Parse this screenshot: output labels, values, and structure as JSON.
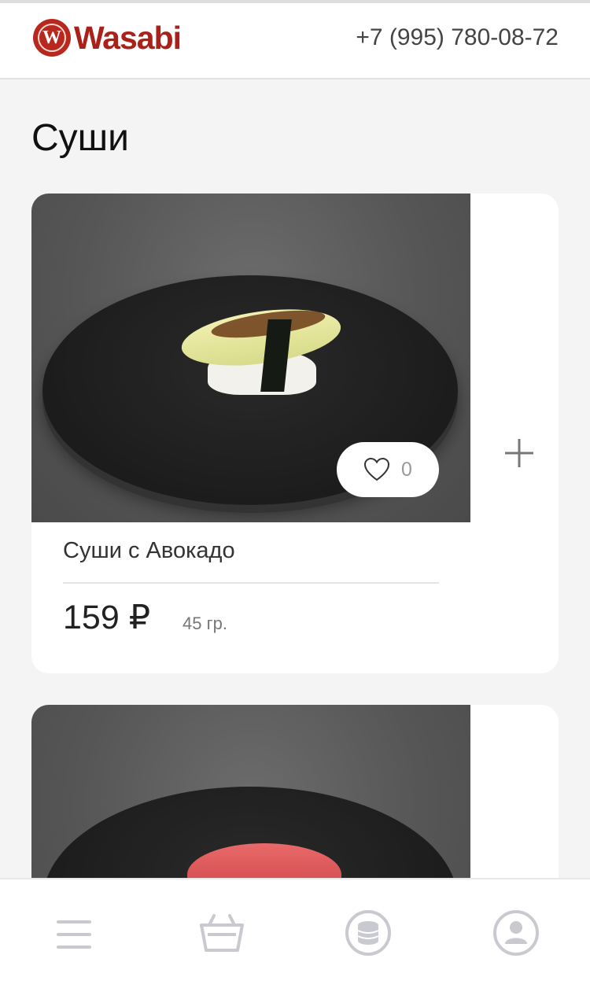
{
  "header": {
    "logo_letter": "W",
    "logo_text": "Wasabi",
    "phone": "+7 (995) 780-08-72"
  },
  "section": {
    "title": "Суши"
  },
  "products": [
    {
      "name": "Суши с Авокадо",
      "price": "159 ₽",
      "weight": "45 гр.",
      "likes": "0"
    }
  ],
  "bottom_nav": {
    "icons": [
      "menu-icon",
      "basket-icon",
      "coins-icon",
      "profile-icon"
    ]
  },
  "colors": {
    "brand_red": "#a92118",
    "icon_gray": "#c9c9d0",
    "background": "#f4f4f4"
  }
}
